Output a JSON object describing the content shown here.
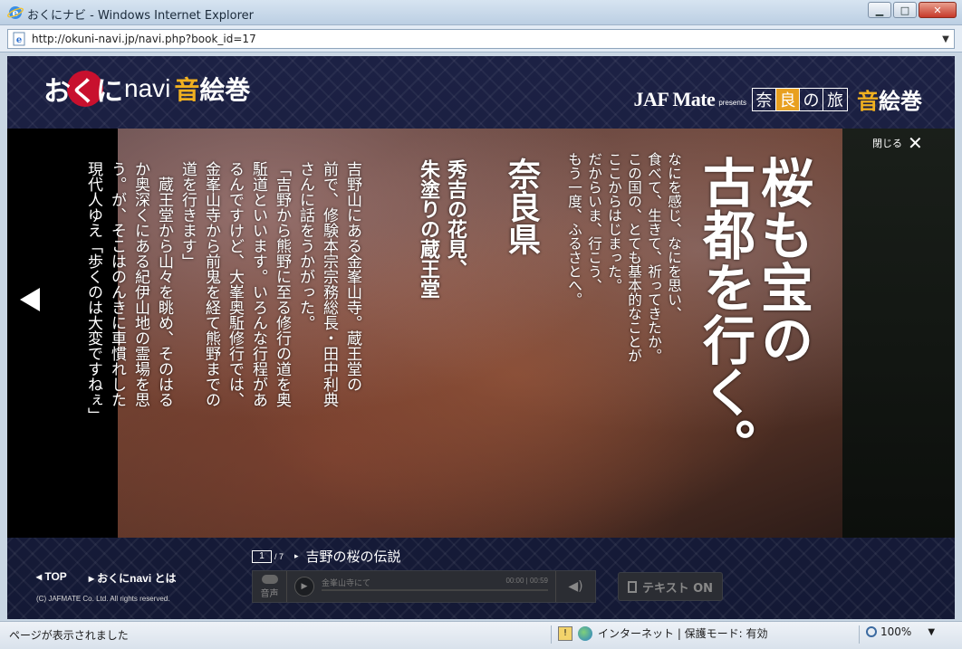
{
  "window": {
    "title": "おくにナビ - Windows Internet Explorer",
    "controls": {
      "minimize": "▁",
      "maximize": "□",
      "close": "✕"
    }
  },
  "address": {
    "url": "http://okuni-navi.jp/navi.php?book_id=17"
  },
  "header": {
    "logo_okuni": "おくに",
    "logo_navi": "navi",
    "logo_oto": "音",
    "logo_emaki": "絵巻",
    "jaf": "JAF Mate",
    "presents": "presents",
    "nara_chars": [
      "奈",
      "良",
      "の",
      "旅"
    ],
    "right_oto": "音",
    "right_emaki": "絵巻"
  },
  "stage": {
    "close_label": "閉じる",
    "close_symbol": "✕",
    "title": "桜も宝の\n古都を行く。",
    "intro": "なにを感じ、なにを思い、\n食べて、生きて、祈ってきたか。\nこの国の、とても基本的なことが\nここからはじまった。\nだからいま、行こう、\nもう一度、ふるさとへ。",
    "prefecture": "奈良県",
    "subtitle": "秀吉の花見、\n朱塗りの蔵王堂",
    "body": "吉野山にある金峯山寺。蔵王堂の\n前で、修験本宗宗務総長・田中利典\nさんに話をうかがった。\n「吉野から熊野に至る修行の道を奥\n駈道といいます。いろんな行程があ\nるんですけど、大峯奥駈修行では、\n金峯山寺から前鬼を経て熊野までの\n道を行きます」\n　蔵王堂から山々を眺め、そのはる\nか奥深くにある紀伊山地の霊場を思\nう。が、そこはのんきに車慣れした\n現代人ゆえ「歩くのは大変ですねぇ」"
  },
  "footer": {
    "top_link": "◂ TOP",
    "about_link": "▸ おくにnavi とは",
    "copyright": "(C) JAFMATE  Co. Ltd. All rights reserved.",
    "page_current": "1",
    "page_total": "/ 7",
    "chapter_arrow": "▸",
    "chapter_title": "吉野の桜の伝説",
    "voice_label": "音声",
    "track_name": "金峯山寺にて",
    "track_time": "00:00 | 00:59",
    "text_on_label": "テキスト ON"
  },
  "status": {
    "text": "ページが表示されました",
    "zone": "インターネット | 保護モード: 有効",
    "zoom": "100%"
  },
  "colors": {
    "accent_gold": "#f0b020",
    "logo_red": "#c8102e",
    "nara_highlight": "#e8a020"
  }
}
